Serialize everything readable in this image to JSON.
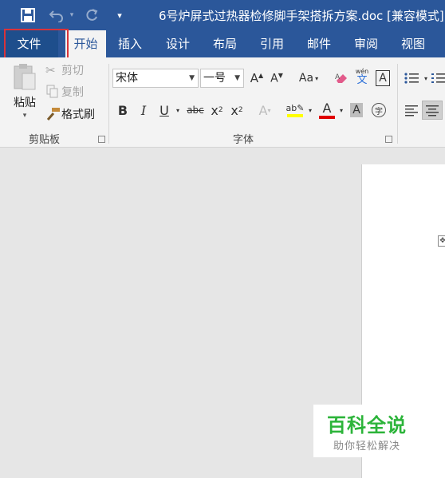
{
  "window": {
    "title": "6号炉屏式过热器检修脚手架搭拆方案.doc [兼容模式]"
  },
  "quick_access": {
    "save_icon": "save-icon",
    "undo_icon": "undo-icon",
    "redo_icon": "redo-icon",
    "customize_icon": "customize-qat-icon"
  },
  "tabs": [
    "文件",
    "开始",
    "插入",
    "设计",
    "布局",
    "引用",
    "邮件",
    "审阅",
    "视图"
  ],
  "active_tab": "开始",
  "clipboard": {
    "paste_label": "粘贴",
    "cut_label": "剪切",
    "copy_label": "复制",
    "format_painter_label": "格式刷",
    "group_label": "剪贴板"
  },
  "font": {
    "font_name": "宋体",
    "font_size": "一号",
    "case_label": "Aa",
    "phonetic_top": "wén",
    "phonetic_bottom": "文",
    "bold": "B",
    "italic": "I",
    "underline": "U",
    "strike": "abc",
    "subscript": "x",
    "subscript_mark": "2",
    "superscript": "x",
    "superscript_mark": "2",
    "color_letter": "A",
    "group_label": "字体"
  },
  "colors": {
    "brand": "#2b579a",
    "highlight_yellow": "#ffff00",
    "font_red": "#e00000",
    "file_tab_outline": "#d9333a",
    "watermark_green": "#2cb43a"
  },
  "watermark": {
    "title": "百科全说",
    "subtitle": "助你轻松解决"
  }
}
